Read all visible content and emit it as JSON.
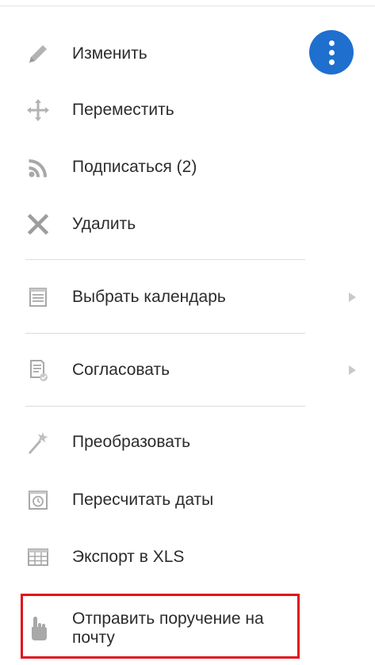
{
  "menu": {
    "items": [
      {
        "label": "Изменить",
        "icon": "pencil-icon"
      },
      {
        "label": "Переместить",
        "icon": "move-icon"
      },
      {
        "label": "Подписаться (2)",
        "icon": "rss-icon"
      },
      {
        "label": "Удалить",
        "icon": "close-icon"
      },
      {
        "label": "Выбрать календарь",
        "icon": "calendar-icon",
        "submenu": true
      },
      {
        "label": "Согласовать",
        "icon": "approve-document-icon",
        "submenu": true
      },
      {
        "label": "Преобразовать",
        "icon": "magic-wand-icon"
      },
      {
        "label": "Пересчитать даты",
        "icon": "recalc-dates-icon"
      },
      {
        "label": "Экспорт в XLS",
        "icon": "table-icon"
      },
      {
        "label": "Отправить поручение на почту",
        "icon": "hand-pointer-icon",
        "highlighted": true
      }
    ]
  },
  "more_button": {
    "icon": "vertical-dots-icon",
    "color": "#1f6fce"
  },
  "colors": {
    "icon_gray": "#b3b3b3",
    "text": "#2c2c2c",
    "divider": "#dcdcdc",
    "highlight_border": "#e0111a"
  }
}
